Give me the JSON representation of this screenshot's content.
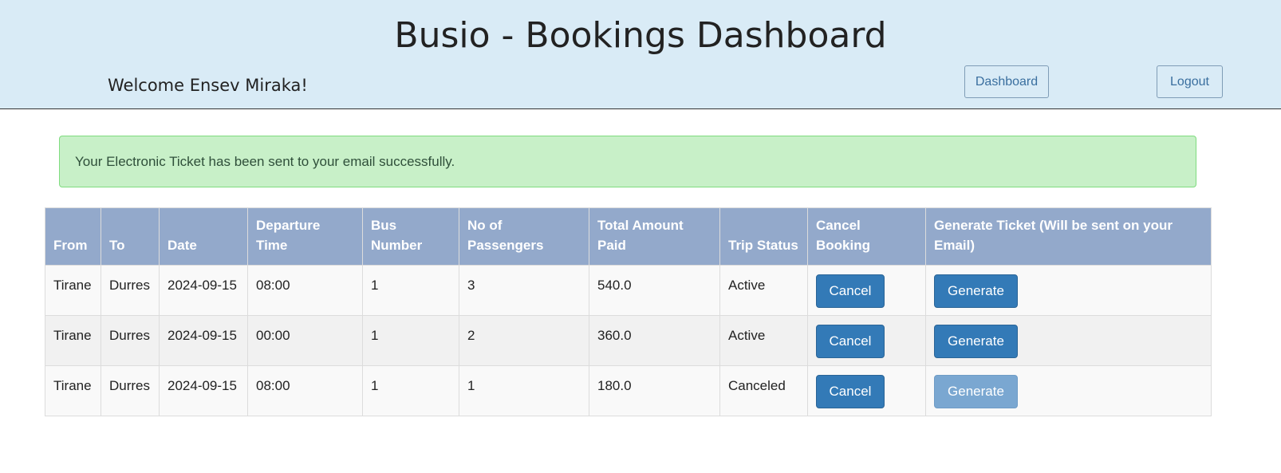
{
  "header": {
    "title": "Busio - Bookings Dashboard",
    "welcome": "Welcome Ensev Miraka!",
    "dashboard_label": "Dashboard",
    "logout_label": "Logout"
  },
  "alert": {
    "message": "Your Electronic Ticket has been sent to your email successfully."
  },
  "table": {
    "headers": [
      "From",
      "To",
      "Date",
      "Departure Time",
      "Bus Number",
      "No of Passengers",
      "Total Amount Paid",
      "Trip Status",
      "Cancel Booking",
      "Generate Ticket (Will be sent on your Email)"
    ],
    "rows": [
      {
        "from": "Tirane",
        "to": "Durres",
        "date": "2024-09-15",
        "departure_time": "08:00",
        "bus_number": "1",
        "passengers": "3",
        "total_paid": "540.0",
        "status": "Active",
        "cancel_label": "Cancel",
        "generate_label": "Generate"
      },
      {
        "from": "Tirane",
        "to": "Durres",
        "date": "2024-09-15",
        "departure_time": "00:00",
        "bus_number": "1",
        "passengers": "2",
        "total_paid": "360.0",
        "status": "Active",
        "cancel_label": "Cancel",
        "generate_label": "Generate"
      },
      {
        "from": "Tirane",
        "to": "Durres",
        "date": "2024-09-15",
        "departure_time": "08:00",
        "bus_number": "1",
        "passengers": "1",
        "total_paid": "180.0",
        "status": "Canceled",
        "cancel_label": "Cancel",
        "generate_label": "Generate"
      }
    ]
  },
  "colors": {
    "header_bg": "#d9ebf6",
    "table_header_bg": "#93a9cb",
    "primary_button": "#337ab7",
    "disabled_button": "#7aa7d1",
    "alert_bg": "#c8f0c8"
  }
}
